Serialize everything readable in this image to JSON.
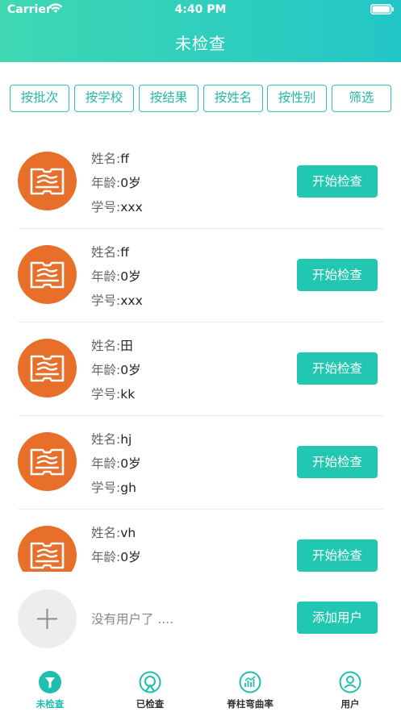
{
  "status_bar": {
    "carrier": "Carrier",
    "time": "4:40 PM"
  },
  "header": {
    "title": "未检查"
  },
  "filters": [
    "按批次",
    "按学校",
    "按结果",
    "按姓名",
    "按性别",
    "筛选"
  ],
  "labels": {
    "name": "姓名:",
    "age": "年龄:",
    "student_id": "学号:"
  },
  "students": [
    {
      "name": "ff",
      "age": "0岁",
      "student_id": "xxx",
      "action": "开始检查"
    },
    {
      "name": "ff",
      "age": "0岁",
      "student_id": "xxx",
      "action": "开始检查"
    },
    {
      "name": "田",
      "age": "0岁",
      "student_id": "kk",
      "action": "开始检查"
    },
    {
      "name": "hj",
      "age": "0岁",
      "student_id": "gh",
      "action": "开始检查"
    },
    {
      "name": "vh",
      "age": "0岁",
      "student_id": "",
      "action": "开始检查"
    }
  ],
  "footer_row": {
    "empty_text": "没有用户了 ....",
    "add_label": "添加用户"
  },
  "tabbar": {
    "items": [
      {
        "label": "未检查",
        "icon": "filter-icon",
        "active": true
      },
      {
        "label": "已检查",
        "icon": "checked-icon",
        "active": false
      },
      {
        "label": "脊柱弯曲率",
        "icon": "chart-icon",
        "active": false
      },
      {
        "label": "用户",
        "icon": "user-icon",
        "active": false
      }
    ]
  },
  "colors": {
    "accent": "#21c7b0",
    "header_start": "#3fd8b2",
    "header_end": "#22c6c7",
    "avatar": "#e86f2a"
  }
}
